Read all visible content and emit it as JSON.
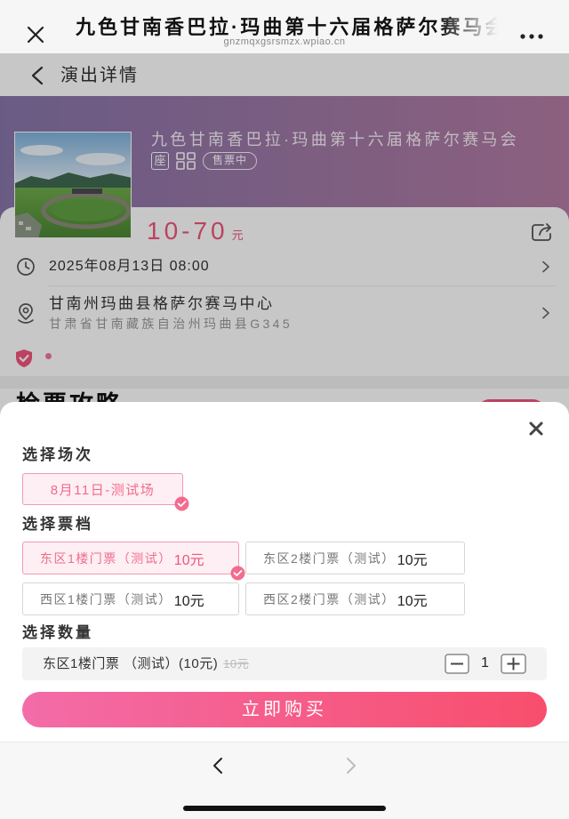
{
  "browser": {
    "title": "九色甘南香巴拉·玛曲第十六届格萨尔赛马会",
    "url": "gnzmqxgsrsmzx.wpiao.cn"
  },
  "page": {
    "header_title": "演出详情",
    "event": {
      "title": "九色甘南香巴拉·玛曲第十六届格萨尔赛马会",
      "seat_tag": "座",
      "status": "售票中",
      "price_range": "10-70",
      "price_unit": "元",
      "datetime": "2025年08月13日 08:00",
      "venue_name": "甘南州玛曲县格萨尔赛马中心",
      "venue_address": "甘肃省甘南藏族自治州玛曲县G345"
    },
    "section_heading": "检票攻略"
  },
  "sheet": {
    "session_heading": "选择场次",
    "sessions": [
      {
        "label": "8月11日-测试场",
        "selected": true
      }
    ],
    "tier_heading": "选择票档",
    "tiers": [
      {
        "name": "东区1楼门票（测试）",
        "price": "10元",
        "selected": true
      },
      {
        "name": "东区2楼门票（测试）",
        "price": "10元",
        "selected": false
      },
      {
        "name": "西区1楼门票（测试）",
        "price": "10元",
        "selected": false
      },
      {
        "name": "西区2楼门票（测试）",
        "price": "10元",
        "selected": false
      }
    ],
    "quantity_heading": "选择数量",
    "quantity": {
      "item_label": "东区1楼门票 （测试）(10元)",
      "original_price": "10元",
      "count": "1"
    },
    "buy_button": "立即购买"
  },
  "icons": {
    "browser_close": "close-icon",
    "browser_more": "more-icon",
    "header_back": "chevron-left-icon",
    "ticket_code": "qrcode-icon",
    "share": "share-icon",
    "time": "clock-icon",
    "venue": "location-icon",
    "row_arrow": "chevron-right-icon",
    "guarantee": "shield-icon",
    "sheet_close": "close-icon",
    "selected_mark": "check-badge-icon",
    "decrease": "minus-icon",
    "increase": "plus-icon",
    "nav_back": "chevron-left-icon",
    "nav_forward": "chevron-right-icon"
  },
  "colors": {
    "accent": "#f0557c",
    "accent_soft": "#fdeff3",
    "accent_border": "#f29ab0",
    "banner_start": "#8776aa",
    "banner_end": "#b47ba3",
    "button_start": "#f36ca8",
    "button_end": "#f84e6c"
  }
}
